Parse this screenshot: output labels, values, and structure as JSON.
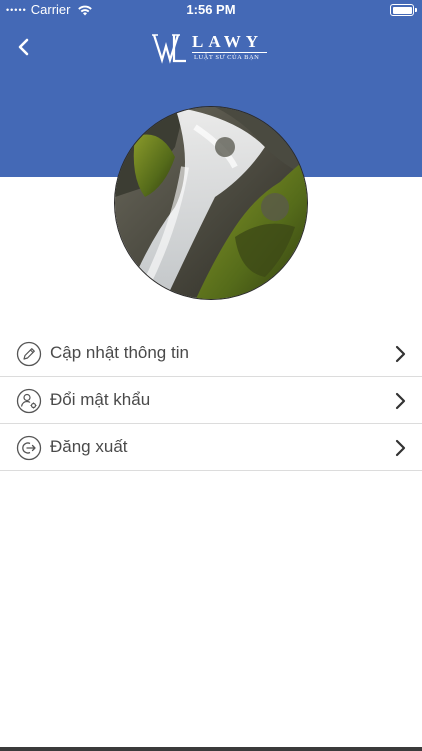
{
  "status_bar": {
    "signal_dots": "•••••",
    "carrier": "Carrier",
    "time": "1:56 PM"
  },
  "header": {
    "back_icon": "chevron-left-icon",
    "logo": {
      "name": "LAWY",
      "tagline": "LUẬT SƯ CỦA BẠN"
    },
    "background_color": "#4469b6"
  },
  "profile": {
    "avatar_image": "waterfall-photo"
  },
  "menu": {
    "items": [
      {
        "label": "Cập nhật thông tin",
        "icon": "pencil-circle-icon"
      },
      {
        "label": "Đổi mật khẩu",
        "icon": "user-key-circle-icon"
      },
      {
        "label": "Đăng xuất",
        "icon": "logout-circle-icon"
      }
    ]
  }
}
